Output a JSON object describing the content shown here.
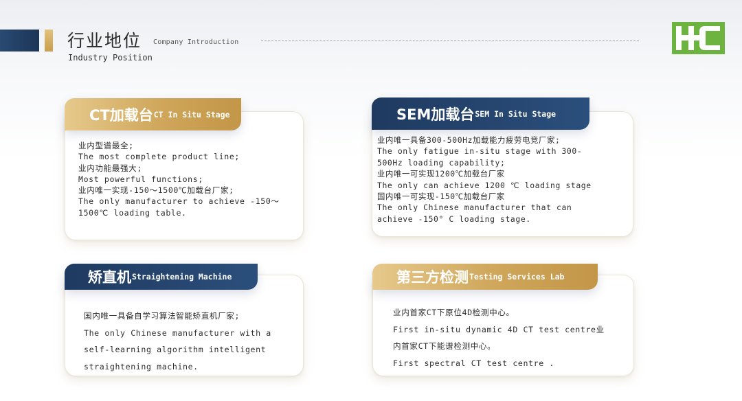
{
  "header": {
    "title": "行业地位",
    "subtitle": "Company Introduction",
    "title_en": "Industry Position"
  },
  "colors": {
    "navy": "#1f3a60",
    "gold": "#c99d4d",
    "logo_green": "#6cb33f"
  },
  "logo": {
    "icon": "hhc-logo"
  },
  "cards": [
    {
      "title_zh": "CT加载台",
      "title_en": "CT In Situ Stage",
      "lines": [
        "业内型谱最全;",
        "The most complete product line;",
        "业内功能最强大;",
        "Most powerful functions;",
        "业内唯一实现-150～1500℃加载台厂家;",
        "The only manufacturer to achieve -150～",
        "1500℃ loading table."
      ]
    },
    {
      "title_zh": "SEM加载台",
      "title_en": "SEM In Situ Stage",
      "lines": [
        "业内唯一具备300-500Hz加载能力疲劳电竞厂家;",
        "The only fatigue in-situ stage with 300-",
        "500Hz loading capability;",
        "业内唯一可实现1200℃加载台厂家",
        "The only can achieve 1200 ℃ loading stage",
        "国内唯一可实现-150℃加载台厂家",
        "The only Chinese manufacturer that can",
        "achieve -150° C loading stage."
      ]
    },
    {
      "title_zh": "矫直机",
      "title_en": "Straightening Machine",
      "lines": [
        "国内唯一具备自学习算法智能矫直机厂家;",
        "The only Chinese manufacturer with a",
        "self-learning algorithm intelligent",
        "straightening machine."
      ]
    },
    {
      "title_zh": "第三方检测",
      "title_en": "Testing Services Lab",
      "lines": [
        "业内首家CT下原位4D检测中心。",
        "First in-situ dynamic 4D CT test centre业",
        "内首家CT下能谱检测中心。",
        "First spectral CT test centre ."
      ]
    }
  ]
}
